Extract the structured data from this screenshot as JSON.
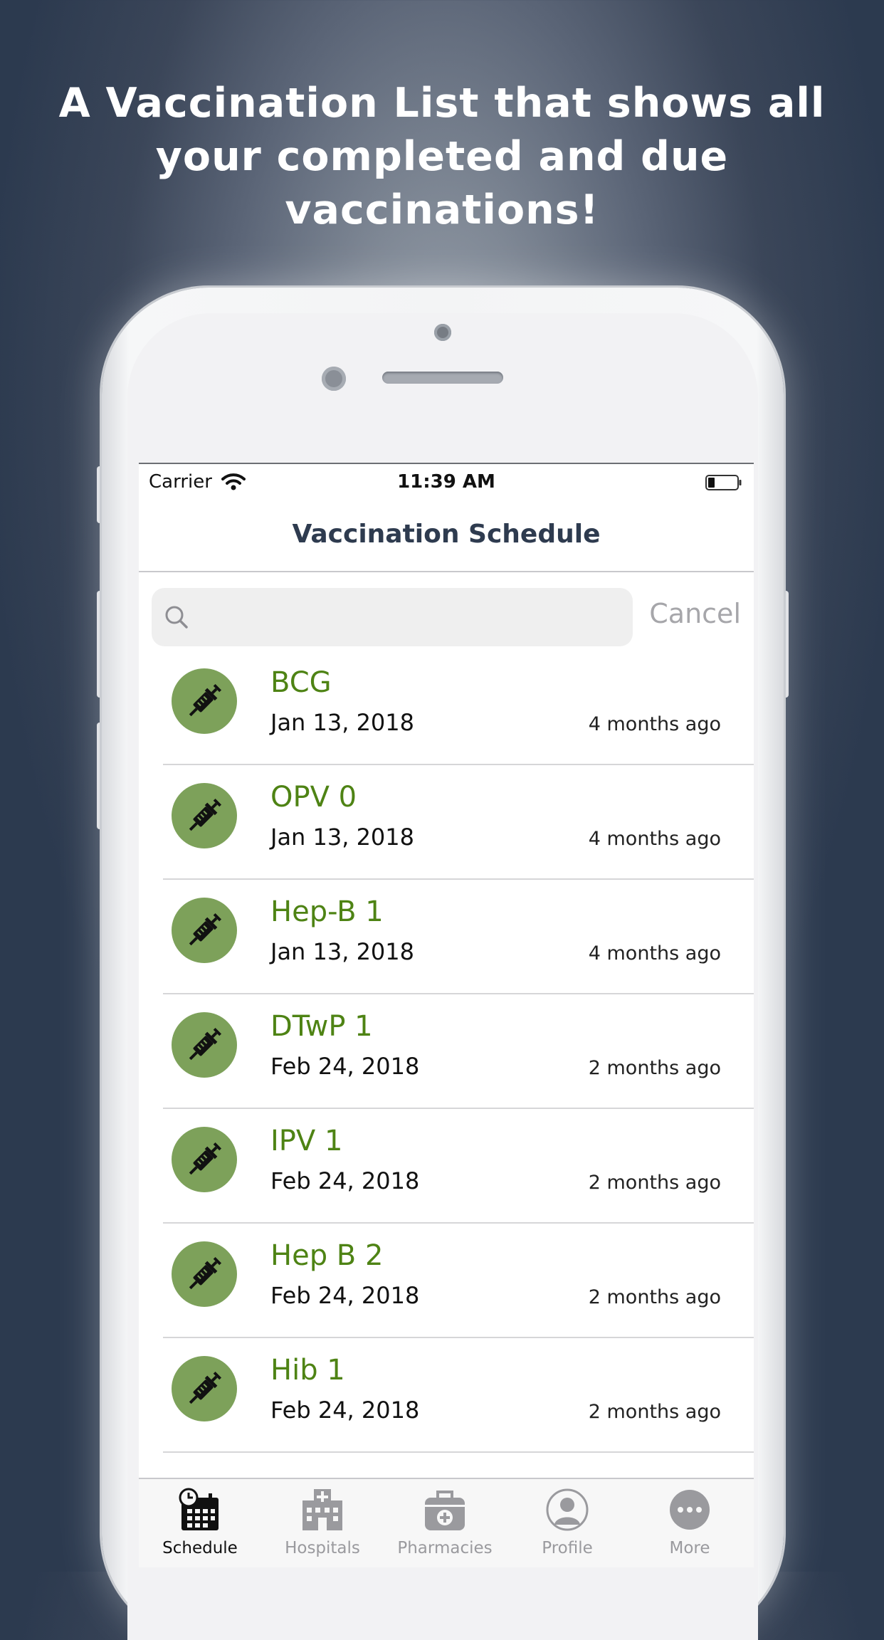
{
  "headline": {
    "line1": "A Vaccination List that shows all",
    "line2": "your completed and due",
    "line3": "vaccinations!"
  },
  "status_bar": {
    "carrier": "Carrier",
    "time": "11:39 AM"
  },
  "nav": {
    "title": "Vaccination Schedule"
  },
  "search": {
    "placeholder": "",
    "cancel_label": "Cancel"
  },
  "vaccines": [
    {
      "name": "BCG",
      "date": "Jan 13, 2018",
      "relative": "4 months ago"
    },
    {
      "name": "OPV 0",
      "date": "Jan 13, 2018",
      "relative": "4 months ago"
    },
    {
      "name": "Hep-B 1",
      "date": "Jan 13, 2018",
      "relative": "4 months ago"
    },
    {
      "name": "DTwP 1",
      "date": "Feb 24, 2018",
      "relative": "2 months ago"
    },
    {
      "name": "IPV 1",
      "date": "Feb 24, 2018",
      "relative": "2 months ago"
    },
    {
      "name": "Hep B 2",
      "date": "Feb 24, 2018",
      "relative": "2 months ago"
    },
    {
      "name": "Hib 1",
      "date": "Feb 24, 2018",
      "relative": "2 months ago"
    }
  ],
  "tabs": [
    {
      "label": "Schedule",
      "icon": "calendar-clock-icon",
      "active": true
    },
    {
      "label": "Hospitals",
      "icon": "hospital-icon",
      "active": false
    },
    {
      "label": "Pharmacies",
      "icon": "medical-bag-icon",
      "active": false
    },
    {
      "label": "Profile",
      "icon": "person-icon",
      "active": false
    },
    {
      "label": "More",
      "icon": "more-icon",
      "active": false
    }
  ],
  "colors": {
    "background": "#2c3a4f",
    "accent_green": "#4e8314",
    "avatar_green": "#7da15a",
    "nav_title": "#2e3b4f"
  }
}
